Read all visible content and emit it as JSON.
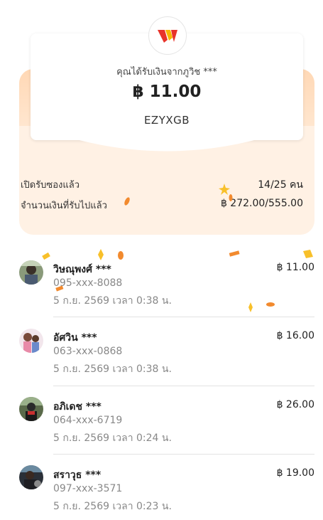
{
  "header": {
    "sender_text": "คุณได้รับเงินจากภูวิช ***",
    "amount": "฿ 11.00",
    "code": "EZYXGB"
  },
  "stats": {
    "opened_label": "เปิดรับซองแล้ว",
    "opened_value": "14/25 คน",
    "received_label": "จำนวนเงินที่รับไปแล้ว",
    "received_value": "฿ 272.00/555.00"
  },
  "recipients": [
    {
      "name": "วิษณุพงศ์ ***",
      "phone": "095-xxx-8088",
      "time": "5 ก.ย. 2569 เวลา 0:38 น.",
      "amount": "฿ 11.00"
    },
    {
      "name": "อัศวิน ***",
      "phone": "063-xxx-0868",
      "time": "5 ก.ย. 2569 เวลา 0:38 น.",
      "amount": "฿ 16.00"
    },
    {
      "name": "อภิเดช ***",
      "phone": "064-xxx-6719",
      "time": "5 ก.ย. 2569 เวลา 0:24 น.",
      "amount": "฿ 26.00"
    },
    {
      "name": "สราวุธ ***",
      "phone": "097-xxx-3571",
      "time": "5 ก.ย. 2569 เวลา 0:23 น.",
      "amount": "฿ 19.00"
    }
  ],
  "colors": {
    "brand_red": "#e8332a",
    "brand_yellow": "#f7b500",
    "envelope_bg": "#fff1e4",
    "confetti_orange": "#f28a2e",
    "confetti_yellow": "#f8c02a"
  },
  "icons": {
    "logo": "truemoney-wallet-logo"
  }
}
